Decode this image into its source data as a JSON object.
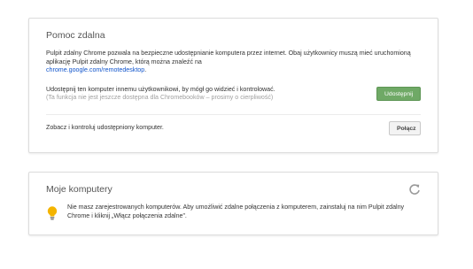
{
  "help_card": {
    "title": "Pomoc zdalna",
    "intro_text": "Pulpit zdalny Chrome pozwala na bezpieczne udostępnianie komputera przez internet. Obaj użytkownicy muszą mieć uruchomioną aplikację Pulpit zdalny Chrome, którą można znaleźć na",
    "intro_link": "chrome.google.com/remotedesktop",
    "intro_link_suffix": ".",
    "share_text": "Udostępnij ten komputer innemu użytkownikowi, by mógł go widzieć i kontrolować.",
    "share_note": "(Ta funkcja nie jest jeszcze dostępna dla Chromebooków – prosimy o cierpliwość)",
    "share_button": "Udostępnij",
    "connect_text": "Zobacz i kontroluj udostępniony komputer.",
    "connect_button": "Połącz"
  },
  "computers_card": {
    "title": "Moje komputery",
    "refresh_icon": "refresh-icon",
    "tip_icon": "lightbulb-icon",
    "empty_text": "Nie masz zarejestrowanych komputerów. Aby umożliwić zdalne połączenia z komputerem, zainstaluj na nim Pulpit zdalny Chrome i kliknij „Włącz połączenia zdalne”."
  },
  "colors": {
    "share_button_bg": "#6fa966",
    "link": "#1155cc",
    "bulb": "#f4b400"
  }
}
